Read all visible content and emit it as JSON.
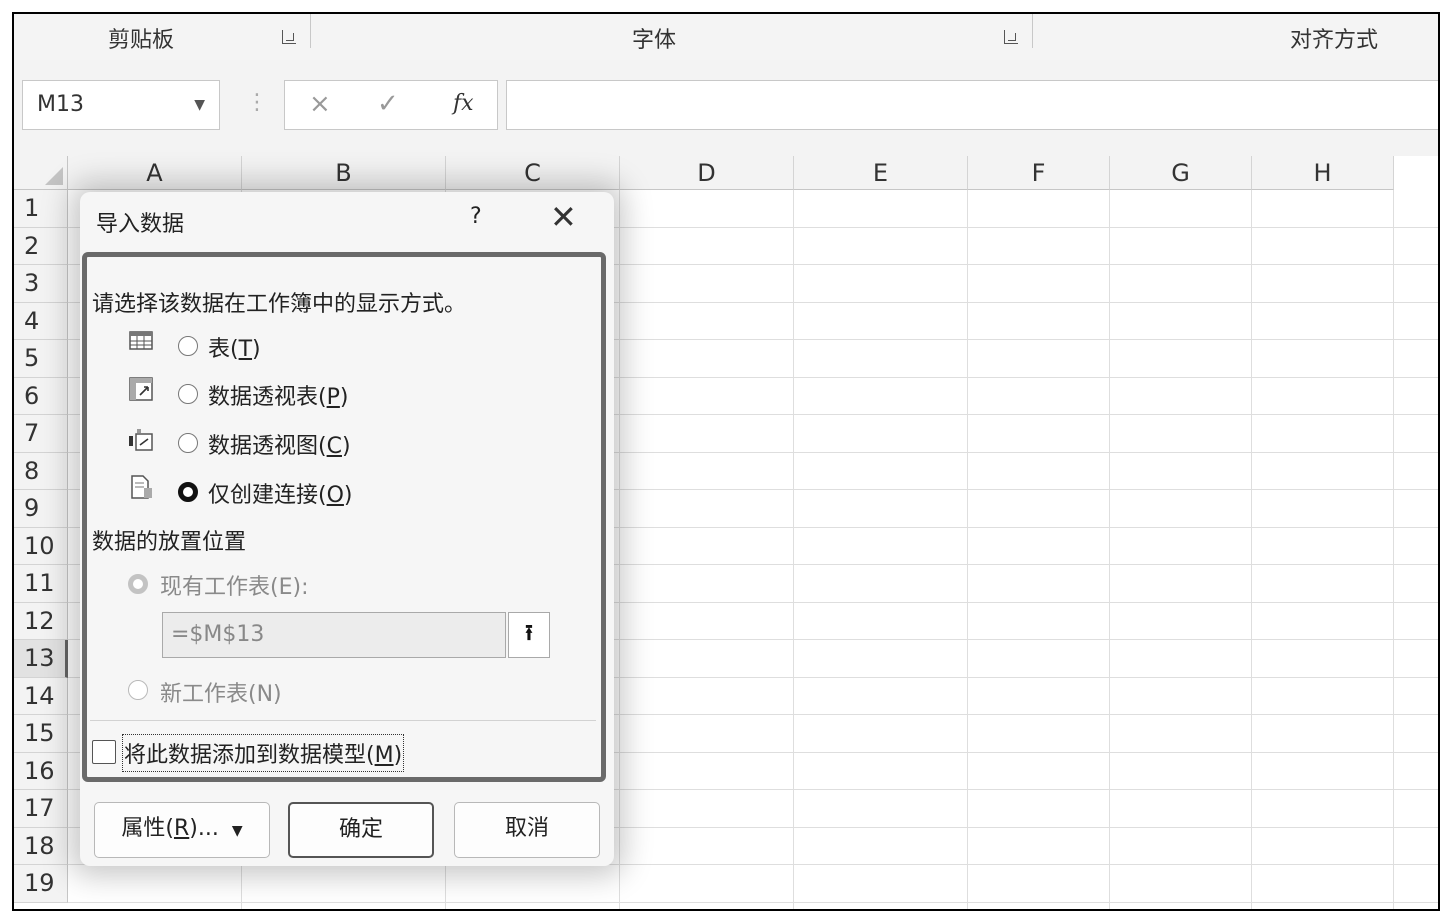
{
  "ribbon": {
    "groups": [
      "剪贴板",
      "字体",
      "对齐方式"
    ]
  },
  "formula_bar": {
    "name_box": "M13",
    "cancel_icon": "×",
    "enter_icon": "✓",
    "fx_label": "fx",
    "formula": ""
  },
  "sheet": {
    "columns": [
      "A",
      "B",
      "C",
      "D",
      "E",
      "F",
      "G",
      "H"
    ],
    "rows": [
      "1",
      "2",
      "3",
      "4",
      "5",
      "6",
      "7",
      "8",
      "9",
      "10",
      "11",
      "12",
      "13",
      "14",
      "15",
      "16",
      "17",
      "18",
      "19"
    ],
    "selected_row": "13"
  },
  "dialog": {
    "title": "导入数据",
    "help": "?",
    "close": "✕",
    "display_prompt": "请选择该数据在工作簿中的显示方式。",
    "display_options": [
      {
        "text": "表(",
        "key": "T",
        "tail": ")",
        "icon": "table-icon",
        "selected": false
      },
      {
        "text": "数据透视表(",
        "key": "P",
        "tail": ")",
        "icon": "pivottable-icon",
        "selected": false
      },
      {
        "text": "数据透视图(",
        "key": "C",
        "tail": ")",
        "icon": "pivotchart-icon",
        "selected": false
      },
      {
        "text": "仅创建连接(",
        "key": "O",
        "tail": ")",
        "icon": "connection-icon",
        "selected": true
      }
    ],
    "location_prompt": "数据的放置位置",
    "existing_sheet": "现有工作表(E):",
    "location_value": "=$M$13",
    "new_sheet": "新工作表(N)",
    "add_to_model_pre": "将此数据添加到数据模型(",
    "add_to_model_key": "M",
    "add_to_model_post": ")",
    "properties_pre": "属性(",
    "properties_key": "R",
    "properties_post": ")...",
    "ok": "确定",
    "cancel": "取消"
  }
}
